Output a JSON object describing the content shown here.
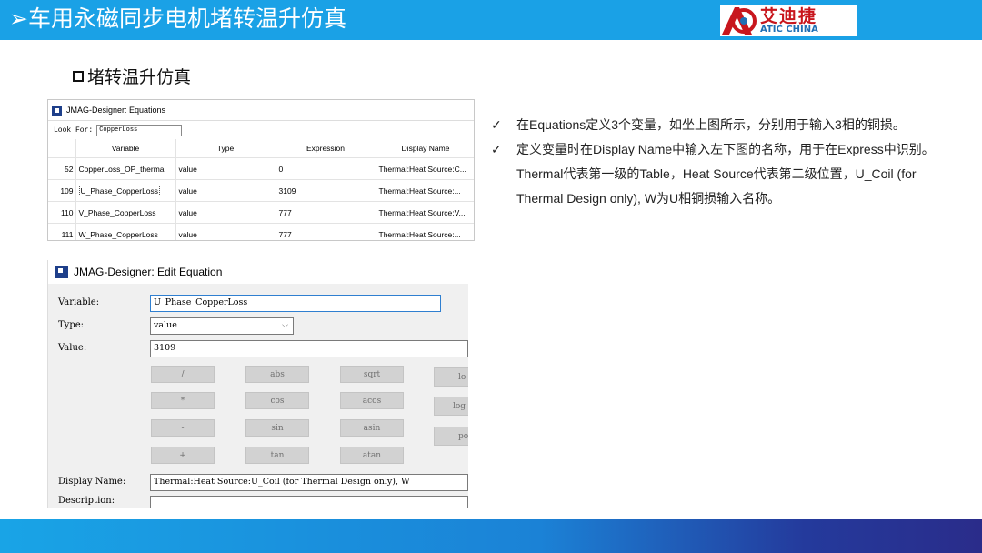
{
  "header": {
    "title": "➢车用永磁同步电机堵转温升仿真",
    "logo_cn": "艾迪捷",
    "logo_en": "ATIC CHINA"
  },
  "section_title": "堵转温升仿真",
  "equations_window": {
    "title": "JMAG-Designer: Equations",
    "look_for_label": "Look For:",
    "look_for_value": "CopperLoss",
    "columns": [
      "Variable",
      "Type",
      "Expression",
      "Display Name"
    ],
    "rows": [
      {
        "index": "52",
        "variable": "CopperLoss_OP_thermal",
        "type": "value",
        "expression": "0",
        "display_name": "Thermal:Heat Source:C..."
      },
      {
        "index": "109",
        "variable": "U_Phase_CopperLoss",
        "type": "value",
        "expression": "3109",
        "display_name": "Thermal:Heat Source:..."
      },
      {
        "index": "110",
        "variable": "V_Phase_CopperLoss",
        "type": "value",
        "expression": "777",
        "display_name": "Thermal:Heat Source:V..."
      },
      {
        "index": "111",
        "variable": "W_Phase_CopperLoss",
        "type": "value",
        "expression": "777",
        "display_name": "Thermal:Heat Source:..."
      }
    ]
  },
  "edit_window": {
    "title": "JMAG-Designer: Edit Equation",
    "variable_label": "Variable:",
    "variable_value": "U_Phase_CopperLoss",
    "type_label": "Type:",
    "type_value": "value",
    "value_label": "Value:",
    "value_value": "3109",
    "function_buttons": [
      "/",
      "abs",
      "sqrt",
      "lo",
      "*",
      "cos",
      "acos",
      "log",
      "-",
      "sin",
      "asin",
      "po",
      "+",
      "tan",
      "atan"
    ],
    "display_name_label": "Display Name:",
    "display_name_value": "Thermal:Heat Source:U_Coil (for Thermal Design only), W",
    "description_label": "Description:"
  },
  "notes": [
    "在Equations定义3个变量，如坐上图所示，分别用于输入3相的铜损。",
    "定义变量时在Display Name中输入左下图的名称，用于在Express中识别。Thermal代表第一级的Table，Heat Source代表第二级位置，U_Coil (for Thermal Design only), W为U相铜损输入名称。"
  ],
  "note_bullet": "✓",
  "colors": {
    "header": "#1aa1e6",
    "logo_red": "#c8161d",
    "logo_blue": "#1f6fb5"
  }
}
